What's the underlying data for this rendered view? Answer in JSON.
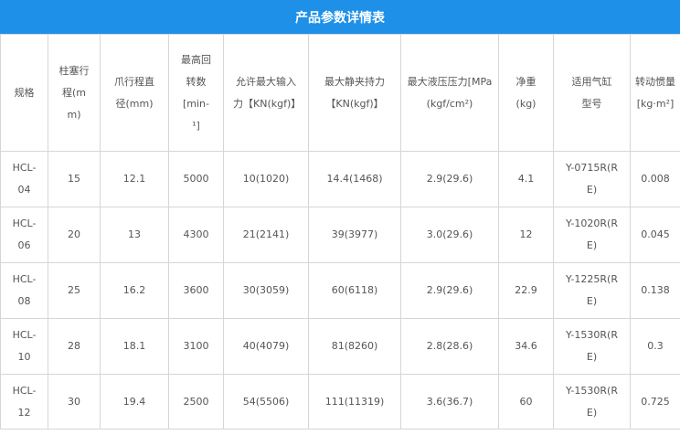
{
  "title": "产品参数详情表",
  "columns": [
    "规格",
    "柱塞行程(mm)",
    "爪行程直径(mm)",
    "最高回转数[min-¹]",
    "允许最大输入力【KN(kgf)】",
    "最大静夹持力【KN(kgf)】",
    "最大液压压力[MPa(kgf/cm²)",
    "净重(kg)",
    "适用气缸型号",
    "转动惯量[kg·m²]"
  ],
  "rows": [
    [
      "HCL-04",
      "15",
      "12.1",
      "5000",
      "10(1020)",
      "14.4(1468)",
      "2.9(29.6)",
      "4.1",
      "Y-0715R(RE)",
      "0.008"
    ],
    [
      "HCL-06",
      "20",
      "13",
      "4300",
      "21(2141)",
      "39(3977)",
      "3.0(29.6)",
      "12",
      "Y-1020R(RE)",
      "0.045"
    ],
    [
      "HCL-08",
      "25",
      "16.2",
      "3600",
      "30(3059)",
      "60(6118)",
      "2.9(29.6)",
      "22.9",
      "Y-1225R(RE)",
      "0.138"
    ],
    [
      "HCL-10",
      "28",
      "18.1",
      "3100",
      "40(4079)",
      "81(8260)",
      "2.8(28.6)",
      "34.6",
      "Y-1530R(RE)",
      "0.3"
    ],
    [
      "HCL-12",
      "30",
      "19.4",
      "2500",
      "54(5506)",
      "111(11319)",
      "3.6(36.7)",
      "60",
      "Y-1530R(RE)",
      "0.725"
    ]
  ]
}
